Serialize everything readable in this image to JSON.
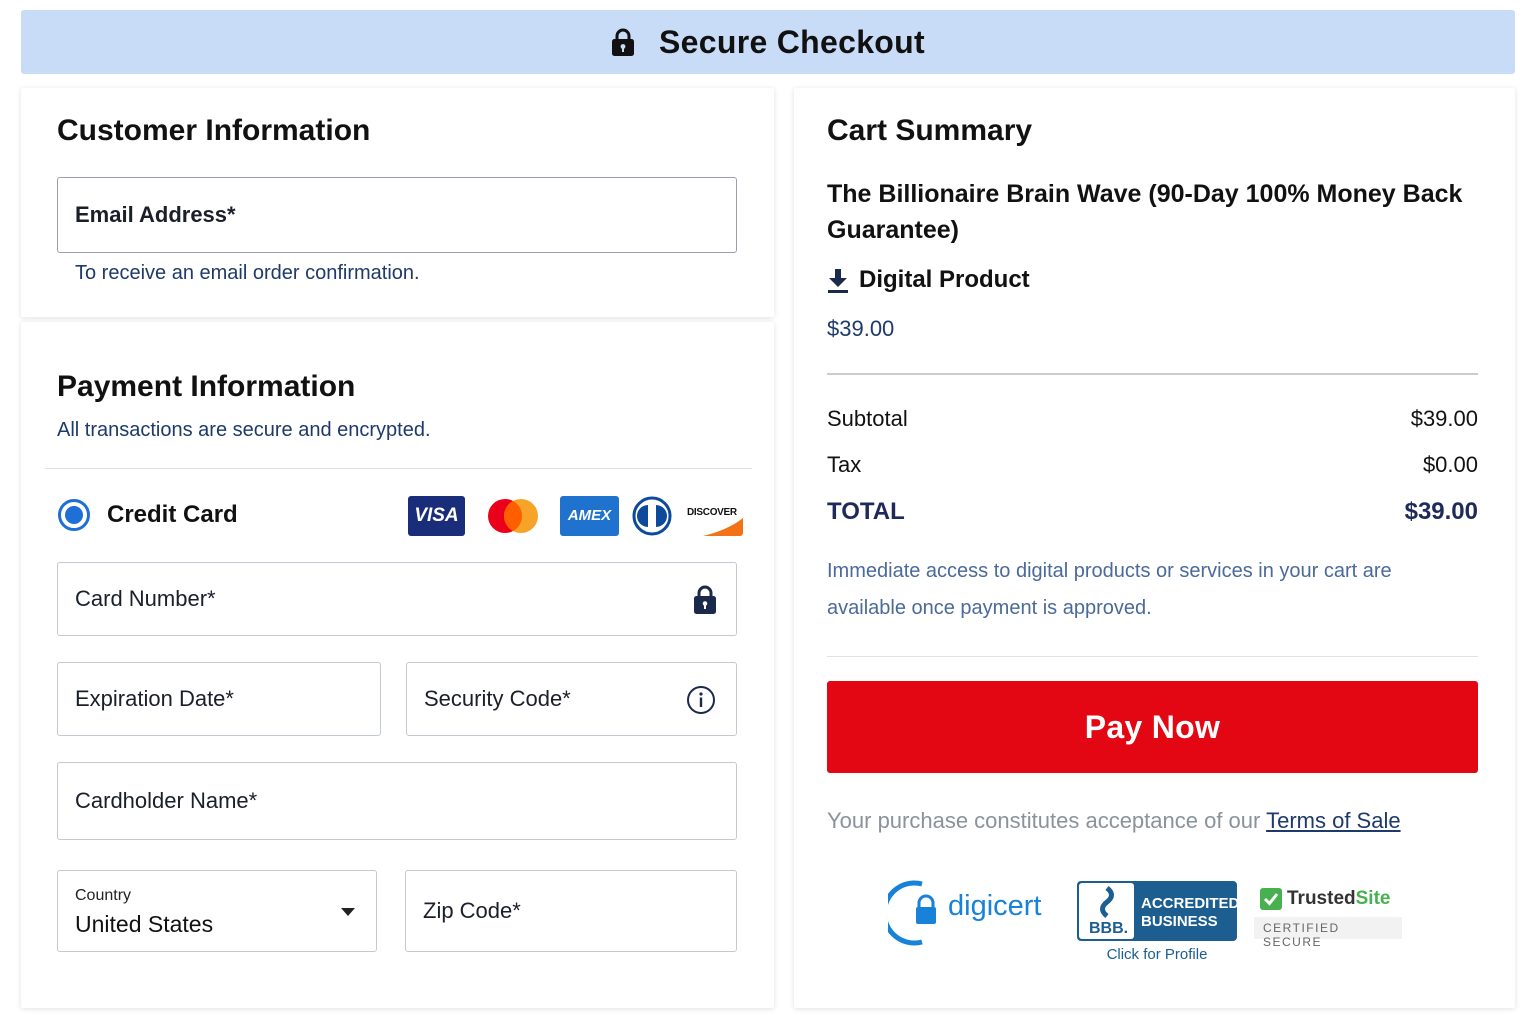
{
  "header": {
    "title": "Secure Checkout"
  },
  "customer": {
    "heading": "Customer Information",
    "email_placeholder": "Email Address*",
    "email_help": "To receive an email order confirmation."
  },
  "payment": {
    "heading": "Payment Information",
    "subtitle": "All transactions are secure and encrypted.",
    "method_label": "Credit Card",
    "card_brands": [
      "VISA",
      "Mastercard",
      "AMEX",
      "Diners Club",
      "DISCOVER"
    ],
    "card_number_placeholder": "Card Number*",
    "expiration_placeholder": "Expiration Date*",
    "security_code_placeholder": "Security Code*",
    "cardholder_placeholder": "Cardholder Name*",
    "country_label": "Country",
    "country_value": "United States",
    "zip_placeholder": "Zip Code*"
  },
  "cart": {
    "heading": "Cart Summary",
    "product_name": "The Billionaire Brain Wave (90-Day 100% Money Back Guarantee)",
    "product_type": "Digital Product",
    "product_price": "$39.00",
    "subtotal_label": "Subtotal",
    "subtotal_value": "$39.00",
    "tax_label": "Tax",
    "tax_value": "$0.00",
    "total_label": "TOTAL",
    "total_value": "$39.00",
    "access_note": "Immediate access to digital products or services in your cart are available once payment is approved.",
    "pay_button": "Pay Now",
    "terms_prefix": "Your purchase constitutes acceptance of our ",
    "terms_link": "Terms of Sale"
  },
  "trust": {
    "digicert": "digicert",
    "bbb_line1": "ACCREDITED",
    "bbb_line2": "BUSINESS",
    "bbb_mark": "BBB.",
    "bbb_link": "Click for Profile",
    "trustedsite_a": "Trusted",
    "trustedsite_b": "Site",
    "trustedsite_sub": "CERTIFIED SECURE"
  },
  "colors": {
    "header_bg": "#c9dcf7",
    "accent_blue": "#1f6fd6",
    "pay_red": "#e30613",
    "navy_text": "#1e3a6a"
  },
  "icons": [
    "lock-icon",
    "download-icon",
    "info-icon",
    "chevron-down-icon"
  ]
}
